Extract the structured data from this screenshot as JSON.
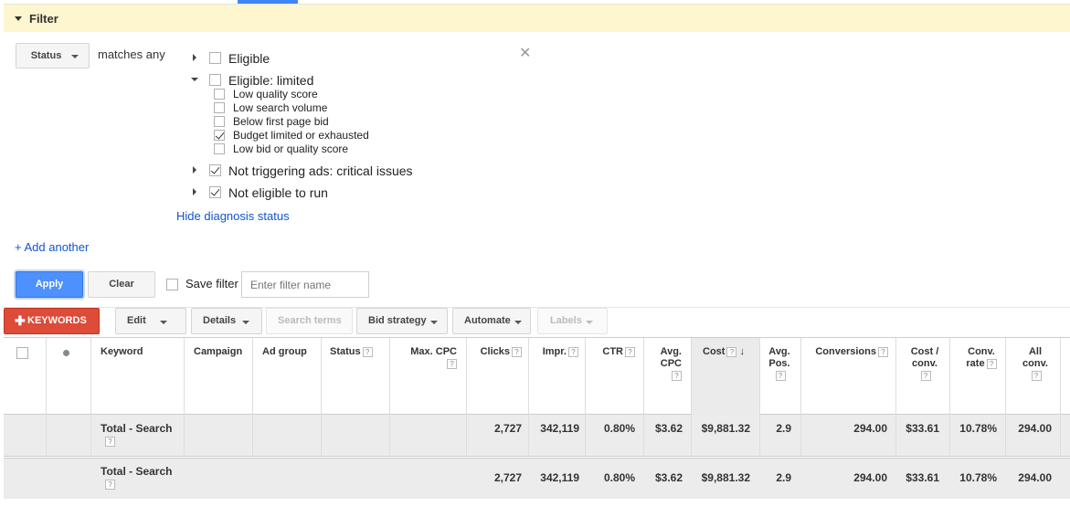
{
  "filter": {
    "title": "Filter",
    "status_button": "Status",
    "matches_text": "matches any",
    "options": [
      {
        "label": "Eligible",
        "checked": false,
        "expanded": false
      },
      {
        "label": "Eligible: limited",
        "checked": false,
        "expanded": true,
        "children": [
          {
            "label": "Low quality score",
            "checked": false
          },
          {
            "label": "Low search volume",
            "checked": false
          },
          {
            "label": "Below first page bid",
            "checked": false
          },
          {
            "label": "Budget limited or exhausted",
            "checked": true
          },
          {
            "label": "Low bid or quality score",
            "checked": false
          }
        ]
      },
      {
        "label": "Not triggering ads: critical issues",
        "checked": true,
        "expanded": false
      },
      {
        "label": "Not eligible to run",
        "checked": true,
        "expanded": false
      }
    ],
    "hide_diagnosis": "Hide diagnosis status",
    "add_another": "+ Add another",
    "apply": "Apply",
    "clear": "Clear",
    "save_filter": "Save filter",
    "filter_name_placeholder": "Enter filter name"
  },
  "toolbar": {
    "keywords": "KEYWORDS",
    "edit": "Edit",
    "details": "Details",
    "search_terms": "Search terms",
    "bid_strategy": "Bid strategy",
    "automate": "Automate",
    "labels": "Labels"
  },
  "table": {
    "headers": {
      "keyword": "Keyword",
      "campaign": "Campaign",
      "ad_group": "Ad group",
      "status": "Status",
      "max_cpc": "Max. CPC",
      "clicks": "Clicks",
      "impr": "Impr.",
      "ctr": "CTR",
      "avg_cpc_1": "Avg.",
      "avg_cpc_2": "CPC",
      "cost": "Cost",
      "avg_pos_1": "Avg.",
      "avg_pos_2": "Pos.",
      "conversions": "Conversions",
      "cost_conv_1": "Cost /",
      "cost_conv_2": "conv.",
      "conv_rate_1": "Conv.",
      "conv_rate_2": "rate",
      "all_conv_1": "All",
      "all_conv_2": "conv."
    },
    "rows": [
      {
        "label": "Total - Search",
        "clicks": "2,727",
        "impr": "342,119",
        "ctr": "0.80%",
        "avg_cpc": "$3.62",
        "cost": "$9,881.32",
        "avg_pos": "2.9",
        "conversions": "294.00",
        "cost_conv": "$33.61",
        "conv_rate": "10.78%",
        "all_conv": "294.00"
      },
      {
        "label": "Total - Search",
        "clicks": "2,727",
        "impr": "342,119",
        "ctr": "0.80%",
        "avg_cpc": "$3.62",
        "cost": "$9,881.32",
        "avg_pos": "2.9",
        "conversions": "294.00",
        "cost_conv": "$33.61",
        "conv_rate": "10.78%",
        "all_conv": "294.00"
      }
    ]
  },
  "colors": {
    "accent": "#4d90fe",
    "keywords_red": "#dd4b39",
    "filter_header_bg": "#fdf6cf",
    "link": "#1155cc"
  }
}
